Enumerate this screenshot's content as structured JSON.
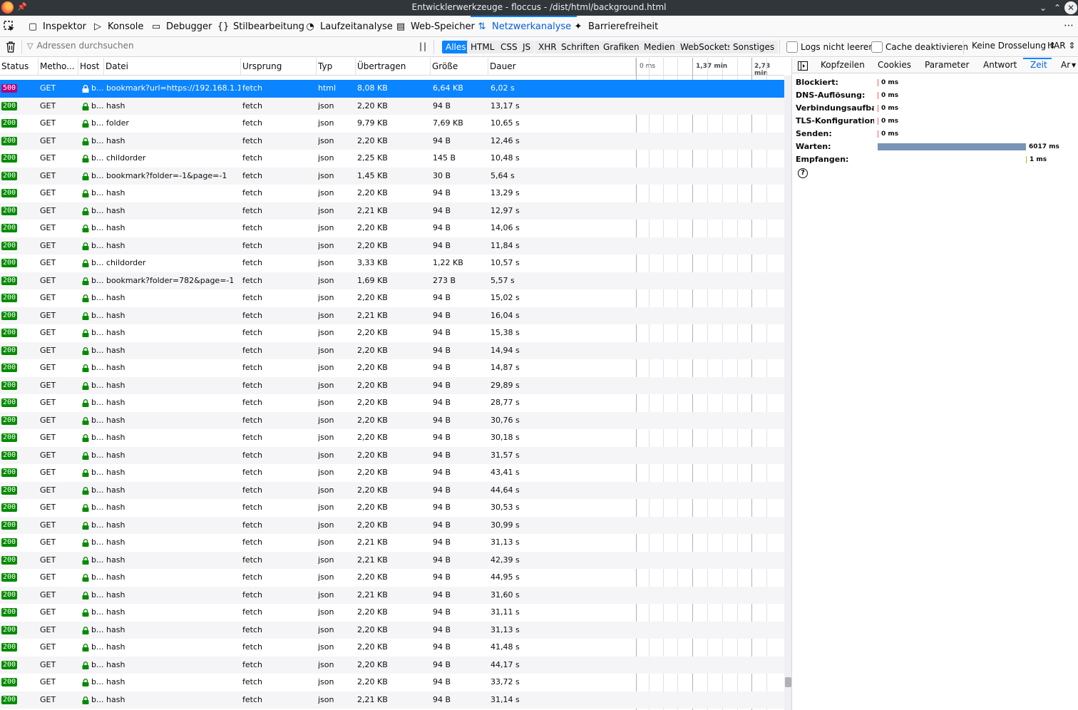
{
  "window": {
    "title": "Entwicklerwerkzeuge - floccus - /dist/html/background.html",
    "min_label": "⌄",
    "max_label": "⌃",
    "close_label": "✕"
  },
  "tooltabs": [
    {
      "label": "Inspektor",
      "icon": "inspector-icon",
      "glyph": "▢"
    },
    {
      "label": "Konsole",
      "icon": "console-icon",
      "glyph": "▷"
    },
    {
      "label": "Debugger",
      "icon": "debugger-icon",
      "glyph": "▭"
    },
    {
      "label": "Stilbearbeitung",
      "icon": "style-editor-icon",
      "glyph": "{}"
    },
    {
      "label": "Laufzeitanalyse",
      "icon": "performance-icon",
      "glyph": "◔"
    },
    {
      "label": "Web-Speicher",
      "icon": "storage-icon",
      "glyph": "▤"
    },
    {
      "label": "Netzwerkanalyse",
      "icon": "network-icon",
      "glyph": "⇅"
    },
    {
      "label": "Barrierefreiheit",
      "icon": "accessibility-icon",
      "glyph": "✦"
    }
  ],
  "tooltab_overflow": "⋯",
  "filter": {
    "placeholder": "Adressen durchsuchen",
    "pause_glyph": "||",
    "types": [
      "Alles",
      "HTML",
      "CSS",
      "JS",
      "XHR",
      "Schriften",
      "Grafiken",
      "Medien",
      "WebSockets",
      "Sonstiges"
    ],
    "active_type": "Alles",
    "persist_logs": "Logs nicht leeren",
    "disable_cache": "Cache deaktivieren",
    "throttling": "Keine Drosselung ⇕",
    "har": "HAR ⇕"
  },
  "columns": [
    "Status",
    "Metho...",
    "Host",
    "Datei",
    "Ursprung",
    "Typ",
    "Übertragen",
    "Größe",
    "Dauer"
  ],
  "waterfall_labels": [
    "0 ms",
    "1,37 min",
    "2,73 min"
  ],
  "rows": [
    {
      "status": "500",
      "method": "GET",
      "host": "b...",
      "file": "bookmark?url=https://192.168.1.1...",
      "cause": "fetch",
      "type": "html",
      "transferred": "8,08 KB",
      "size": "6,64 KB",
      "duration": "6,02 s",
      "selected": true
    },
    {
      "status": "200",
      "method": "GET",
      "host": "b...",
      "file": "hash",
      "cause": "fetch",
      "type": "json",
      "transferred": "2,20 KB",
      "size": "94 B",
      "duration": "13,17 s"
    },
    {
      "status": "200",
      "method": "GET",
      "host": "b...",
      "file": "folder",
      "cause": "fetch",
      "type": "json",
      "transferred": "9,79 KB",
      "size": "7,69 KB",
      "duration": "10,65 s"
    },
    {
      "status": "200",
      "method": "GET",
      "host": "b...",
      "file": "hash",
      "cause": "fetch",
      "type": "json",
      "transferred": "2,20 KB",
      "size": "94 B",
      "duration": "12,46 s"
    },
    {
      "status": "200",
      "method": "GET",
      "host": "b...",
      "file": "childorder",
      "cause": "fetch",
      "type": "json",
      "transferred": "2,25 KB",
      "size": "145 B",
      "duration": "10,48 s"
    },
    {
      "status": "200",
      "method": "GET",
      "host": "b...",
      "file": "bookmark?folder=-1&page=-1",
      "cause": "fetch",
      "type": "json",
      "transferred": "1,45 KB",
      "size": "30 B",
      "duration": "5,64 s"
    },
    {
      "status": "200",
      "method": "GET",
      "host": "b...",
      "file": "hash",
      "cause": "fetch",
      "type": "json",
      "transferred": "2,20 KB",
      "size": "94 B",
      "duration": "13,29 s"
    },
    {
      "status": "200",
      "method": "GET",
      "host": "b...",
      "file": "hash",
      "cause": "fetch",
      "type": "json",
      "transferred": "2,21 KB",
      "size": "94 B",
      "duration": "12,97 s"
    },
    {
      "status": "200",
      "method": "GET",
      "host": "b...",
      "file": "hash",
      "cause": "fetch",
      "type": "json",
      "transferred": "2,20 KB",
      "size": "94 B",
      "duration": "14,06 s"
    },
    {
      "status": "200",
      "method": "GET",
      "host": "b...",
      "file": "hash",
      "cause": "fetch",
      "type": "json",
      "transferred": "2,20 KB",
      "size": "94 B",
      "duration": "11,84 s"
    },
    {
      "status": "200",
      "method": "GET",
      "host": "b...",
      "file": "childorder",
      "cause": "fetch",
      "type": "json",
      "transferred": "3,33 KB",
      "size": "1,22 KB",
      "duration": "10,57 s"
    },
    {
      "status": "200",
      "method": "GET",
      "host": "b...",
      "file": "bookmark?folder=782&page=-1",
      "cause": "fetch",
      "type": "json",
      "transferred": "1,69 KB",
      "size": "273 B",
      "duration": "5,57 s"
    },
    {
      "status": "200",
      "method": "GET",
      "host": "b...",
      "file": "hash",
      "cause": "fetch",
      "type": "json",
      "transferred": "2,20 KB",
      "size": "94 B",
      "duration": "15,02 s"
    },
    {
      "status": "200",
      "method": "GET",
      "host": "b...",
      "file": "hash",
      "cause": "fetch",
      "type": "json",
      "transferred": "2,21 KB",
      "size": "94 B",
      "duration": "16,04 s"
    },
    {
      "status": "200",
      "method": "GET",
      "host": "b...",
      "file": "hash",
      "cause": "fetch",
      "type": "json",
      "transferred": "2,20 KB",
      "size": "94 B",
      "duration": "15,38 s"
    },
    {
      "status": "200",
      "method": "GET",
      "host": "b...",
      "file": "hash",
      "cause": "fetch",
      "type": "json",
      "transferred": "2,20 KB",
      "size": "94 B",
      "duration": "14,94 s"
    },
    {
      "status": "200",
      "method": "GET",
      "host": "b...",
      "file": "hash",
      "cause": "fetch",
      "type": "json",
      "transferred": "2,20 KB",
      "size": "94 B",
      "duration": "14,87 s"
    },
    {
      "status": "200",
      "method": "GET",
      "host": "b...",
      "file": "hash",
      "cause": "fetch",
      "type": "json",
      "transferred": "2,20 KB",
      "size": "94 B",
      "duration": "29,89 s"
    },
    {
      "status": "200",
      "method": "GET",
      "host": "b...",
      "file": "hash",
      "cause": "fetch",
      "type": "json",
      "transferred": "2,20 KB",
      "size": "94 B",
      "duration": "28,77 s"
    },
    {
      "status": "200",
      "method": "GET",
      "host": "b...",
      "file": "hash",
      "cause": "fetch",
      "type": "json",
      "transferred": "2,20 KB",
      "size": "94 B",
      "duration": "30,76 s"
    },
    {
      "status": "200",
      "method": "GET",
      "host": "b...",
      "file": "hash",
      "cause": "fetch",
      "type": "json",
      "transferred": "2,20 KB",
      "size": "94 B",
      "duration": "30,18 s"
    },
    {
      "status": "200",
      "method": "GET",
      "host": "b...",
      "file": "hash",
      "cause": "fetch",
      "type": "json",
      "transferred": "2,20 KB",
      "size": "94 B",
      "duration": "31,57 s"
    },
    {
      "status": "200",
      "method": "GET",
      "host": "b...",
      "file": "hash",
      "cause": "fetch",
      "type": "json",
      "transferred": "2,20 KB",
      "size": "94 B",
      "duration": "43,41 s"
    },
    {
      "status": "200",
      "method": "GET",
      "host": "b...",
      "file": "hash",
      "cause": "fetch",
      "type": "json",
      "transferred": "2,20 KB",
      "size": "94 B",
      "duration": "44,64 s"
    },
    {
      "status": "200",
      "method": "GET",
      "host": "b...",
      "file": "hash",
      "cause": "fetch",
      "type": "json",
      "transferred": "2,20 KB",
      "size": "94 B",
      "duration": "30,53 s"
    },
    {
      "status": "200",
      "method": "GET",
      "host": "b...",
      "file": "hash",
      "cause": "fetch",
      "type": "json",
      "transferred": "2,20 KB",
      "size": "94 B",
      "duration": "30,99 s"
    },
    {
      "status": "200",
      "method": "GET",
      "host": "b...",
      "file": "hash",
      "cause": "fetch",
      "type": "json",
      "transferred": "2,21 KB",
      "size": "94 B",
      "duration": "31,13 s"
    },
    {
      "status": "200",
      "method": "GET",
      "host": "b...",
      "file": "hash",
      "cause": "fetch",
      "type": "json",
      "transferred": "2,21 KB",
      "size": "94 B",
      "duration": "42,39 s"
    },
    {
      "status": "200",
      "method": "GET",
      "host": "b...",
      "file": "hash",
      "cause": "fetch",
      "type": "json",
      "transferred": "2,20 KB",
      "size": "94 B",
      "duration": "44,95 s"
    },
    {
      "status": "200",
      "method": "GET",
      "host": "b...",
      "file": "hash",
      "cause": "fetch",
      "type": "json",
      "transferred": "2,21 KB",
      "size": "94 B",
      "duration": "31,60 s"
    },
    {
      "status": "200",
      "method": "GET",
      "host": "b...",
      "file": "hash",
      "cause": "fetch",
      "type": "json",
      "transferred": "2,20 KB",
      "size": "94 B",
      "duration": "31,11 s"
    },
    {
      "status": "200",
      "method": "GET",
      "host": "b...",
      "file": "hash",
      "cause": "fetch",
      "type": "json",
      "transferred": "2,20 KB",
      "size": "94 B",
      "duration": "31,13 s"
    },
    {
      "status": "200",
      "method": "GET",
      "host": "b...",
      "file": "hash",
      "cause": "fetch",
      "type": "json",
      "transferred": "2,20 KB",
      "size": "94 B",
      "duration": "41,48 s"
    },
    {
      "status": "200",
      "method": "GET",
      "host": "b...",
      "file": "hash",
      "cause": "fetch",
      "type": "json",
      "transferred": "2,20 KB",
      "size": "94 B",
      "duration": "44,17 s"
    },
    {
      "status": "200",
      "method": "GET",
      "host": "b...",
      "file": "hash",
      "cause": "fetch",
      "type": "json",
      "transferred": "2,20 KB",
      "size": "94 B",
      "duration": "33,72 s"
    },
    {
      "status": "200",
      "method": "GET",
      "host": "b...",
      "file": "hash",
      "cause": "fetch",
      "type": "json",
      "transferred": "2,21 KB",
      "size": "94 B",
      "duration": "31,14 s"
    }
  ],
  "side": {
    "tabs": [
      "Kopfzeilen",
      "Cookies",
      "Parameter",
      "Antwort",
      "Zeit",
      "Ar"
    ],
    "active_tab": "Zeit",
    "timings": [
      {
        "label": "Blockiert:",
        "value": "0 ms",
        "ms": 0
      },
      {
        "label": "DNS-Auflösung:",
        "value": "0 ms",
        "ms": 0
      },
      {
        "label": "Verbindungsaufbau:",
        "value": "0 ms",
        "ms": 0
      },
      {
        "label": "TLS-Konfiguration:",
        "value": "0 ms",
        "ms": 0
      },
      {
        "label": "Senden:",
        "value": "0 ms",
        "ms": 0
      },
      {
        "label": "Warten:",
        "value": "6017 ms",
        "ms": 6017
      },
      {
        "label": "Empfangen:",
        "value": "1 ms",
        "ms": 1
      }
    ],
    "help_glyph": "?"
  },
  "colors": {
    "accent": "#0a84ff",
    "status_ok": "#058b00",
    "status_error": "#b5007f",
    "wait_bar": "#7895b8",
    "tick_blocked": "#ff5a5a",
    "tick_receive": "#e8a30f"
  }
}
